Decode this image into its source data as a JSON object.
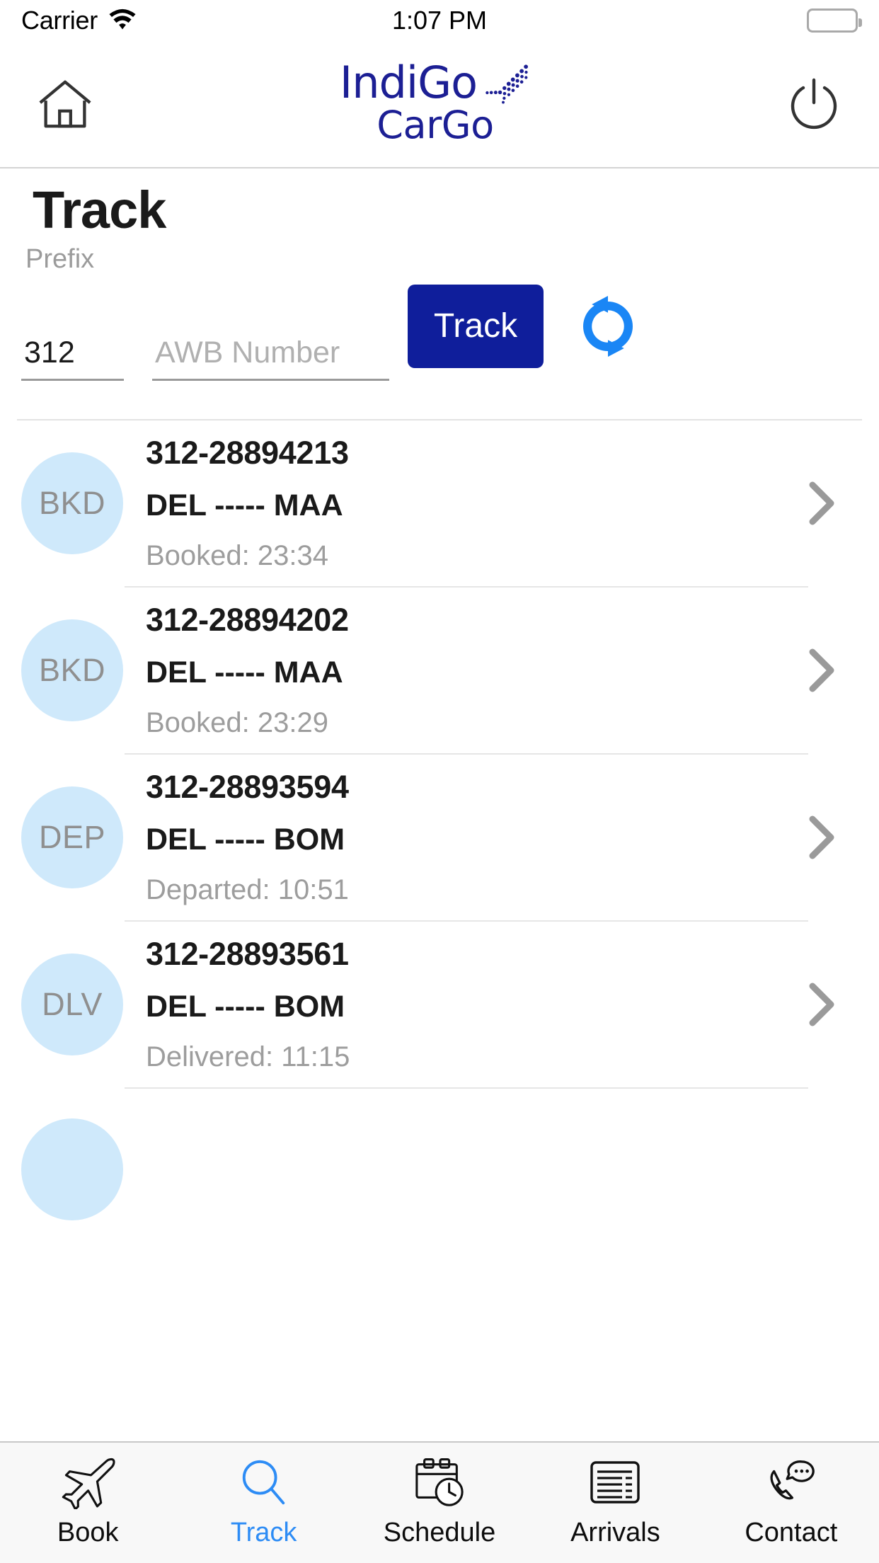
{
  "status_bar": {
    "carrier": "Carrier",
    "wifi_icon": "wifi-icon",
    "time": "1:07 PM",
    "battery_icon": "battery-full-icon"
  },
  "navbar": {
    "home_icon": "home-icon",
    "power_icon": "power-icon",
    "brand_primary": "IndiGo",
    "brand_secondary": "CarGo",
    "brand_mark_icon": "dotted-plane-icon",
    "brand_color": "#1c1f94"
  },
  "page": {
    "title": "Track",
    "prefix_label": "Prefix"
  },
  "search": {
    "prefix_value": "312",
    "prefix_placeholder": "Prefix",
    "awb_value": "",
    "awb_placeholder": "AWB Number",
    "track_button": "Track",
    "refresh_icon": "refresh-icon",
    "track_button_color": "#0f1e9b",
    "refresh_icon_color": "#1a86f5"
  },
  "shipments": [
    {
      "status": "BKD",
      "awb": "312-28894213",
      "origin": "DEL",
      "destination": "MAA",
      "route": "DEL ----- MAA",
      "time_text": "Booked: 23:34"
    },
    {
      "status": "BKD",
      "awb": "312-28894202",
      "origin": "DEL",
      "destination": "MAA",
      "route": "DEL ----- MAA",
      "time_text": "Booked: 23:29"
    },
    {
      "status": "DEP",
      "awb": "312-28893594",
      "origin": "DEL",
      "destination": "BOM",
      "route": "DEL ----- BOM",
      "time_text": "Departed: 10:51"
    },
    {
      "status": "DLV",
      "awb": "312-28893561",
      "origin": "DEL",
      "destination": "BOM",
      "route": "DEL ----- BOM",
      "time_text": "Delivered: 11:15"
    }
  ],
  "list_meta": {
    "status_circle_color": "#cfe9fb",
    "status_text_color": "#8f8f8f",
    "chevron_icon": "chevron-right-icon"
  },
  "tabs": [
    {
      "label": "Book",
      "icon": "airplane-icon",
      "active": false
    },
    {
      "label": "Track",
      "icon": "search-icon",
      "active": true
    },
    {
      "label": "Schedule",
      "icon": "calendar-clock-icon",
      "active": false
    },
    {
      "label": "Arrivals",
      "icon": "list-board-icon",
      "active": false
    },
    {
      "label": "Contact",
      "icon": "phone-chat-icon",
      "active": false
    }
  ],
  "tab_active_color": "#2d8cf5"
}
